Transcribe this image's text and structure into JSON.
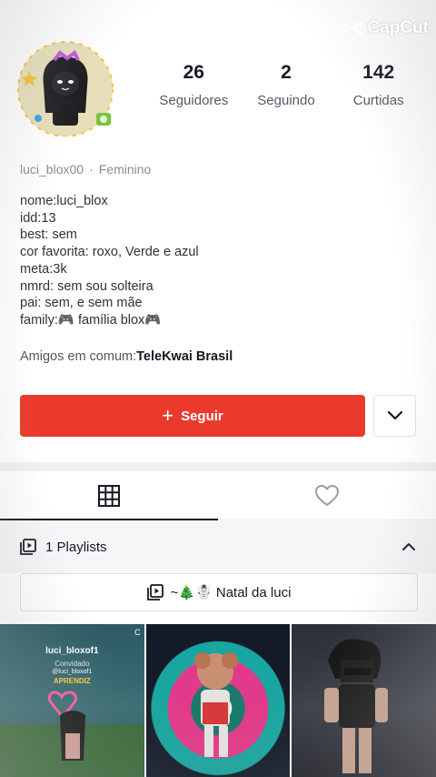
{
  "watermark": "CapCut",
  "profile": {
    "stats": [
      {
        "value": "26",
        "label": "Seguidores"
      },
      {
        "value": "2",
        "label": "Seguindo"
      },
      {
        "value": "142",
        "label": "Curtidas"
      }
    ],
    "username": "luci_blox00",
    "gender": "Feminino",
    "bio_lines": [
      "nome:luci_blox",
      "idd:13",
      "best: sem",
      "cor favorita: roxo, Verde e azul",
      "meta:3k",
      "nmrd: sem sou solteira",
      "pai: sem, e sem mãe",
      "family:🎮 família blox🎮"
    ],
    "mutual_prefix": "Amigos em comum:",
    "mutual_name": "TeleKwai Brasil"
  },
  "actions": {
    "follow_icon": "+",
    "follow_label": "Seguir",
    "more_icon": "chevron-down-icon"
  },
  "tabs": [
    {
      "icon": "grid-icon",
      "active": true
    },
    {
      "icon": "heart-icon",
      "active": false
    }
  ],
  "playlists": {
    "header": "1 Playlists",
    "items": [
      {
        "title": "~🎄☃️ Natal da luci"
      }
    ]
  },
  "videos": [
    {
      "overlay_name": "luci_bloxof1",
      "overlay_sub1": "Convidado",
      "overlay_sub2": "@luci_bloxof1",
      "overlay_sub3": "APRENDIZ",
      "badge": "C"
    },
    {},
    {}
  ],
  "colors": {
    "accent": "#ea3a2c",
    "text_primary": "#161823",
    "text_secondary": "#8a8b91"
  }
}
